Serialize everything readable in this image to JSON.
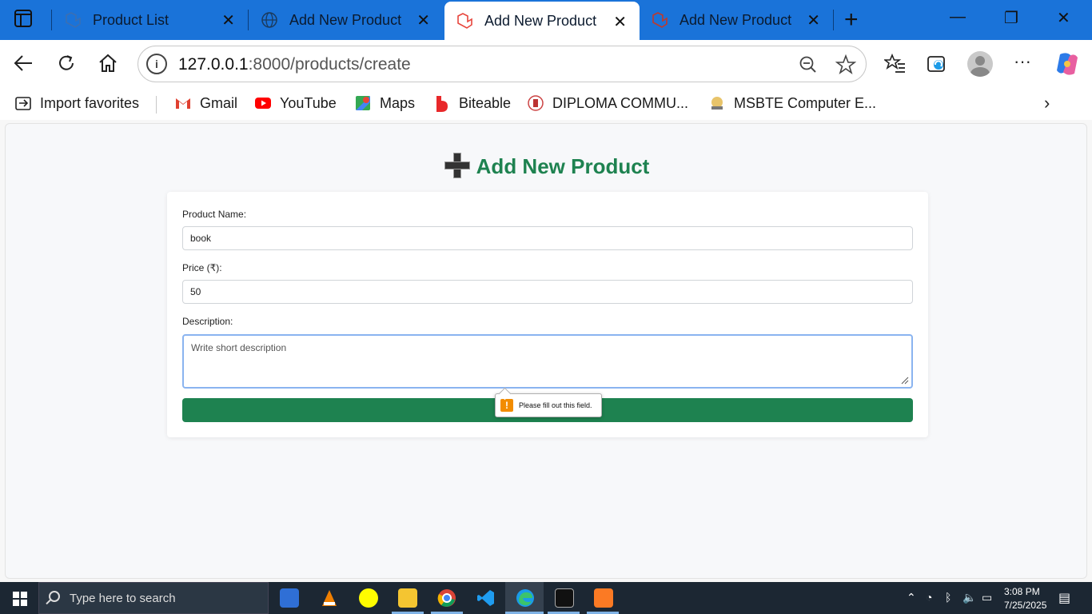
{
  "browser": {
    "tabs": [
      {
        "title": "Product List",
        "active": false
      },
      {
        "title": "Add New Product",
        "active": false
      },
      {
        "title": "Add New Product",
        "active": true
      },
      {
        "title": "Add New Product",
        "active": false
      }
    ],
    "url_host": "127.0.0.1",
    "url_rest": ":8000/products/create",
    "favorites": [
      {
        "label": "Import favorites",
        "icon": "import-icon"
      },
      {
        "label": "Gmail",
        "icon": "gmail-icon"
      },
      {
        "label": "YouTube",
        "icon": "youtube-icon"
      },
      {
        "label": "Maps",
        "icon": "maps-icon"
      },
      {
        "label": "Biteable",
        "icon": "biteable-icon"
      },
      {
        "label": "DIPLOMA COMMU...",
        "icon": "diploma-icon"
      },
      {
        "label": "MSBTE Computer E...",
        "icon": "msbte-icon"
      }
    ]
  },
  "page": {
    "heading": "Add New Product",
    "form": {
      "name_label": "Product Name:",
      "name_value": "book",
      "price_label": "Price (₹):",
      "price_value": "50",
      "description_label": "Description:",
      "description_placeholder": "Write short description"
    },
    "validation_tooltip": "Please fill out this field."
  },
  "taskbar": {
    "search_placeholder": "Type here to search",
    "time": "3:08 PM",
    "date": "7/25/2025"
  },
  "colors": {
    "accent_green": "#1e8250",
    "tab_bar_blue": "#1a73d9",
    "warning_orange": "#f28c00"
  }
}
